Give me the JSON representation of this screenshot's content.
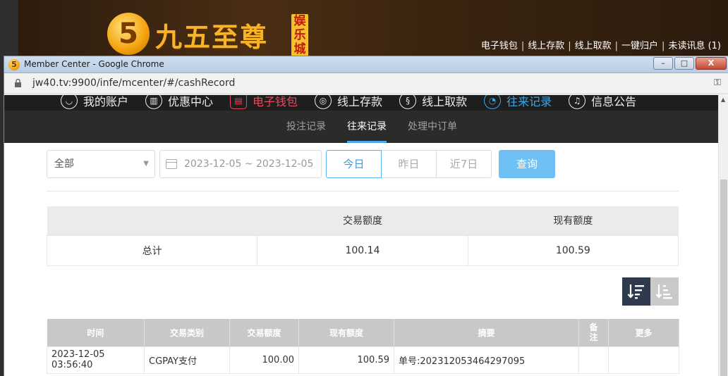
{
  "site": {
    "logo_glyph": "5",
    "logo_text": "九五至尊",
    "logo_badge": "娱乐城",
    "top_links": [
      "电子钱包",
      "线上存款",
      "线上取款",
      "一键归户",
      "未读讯息 (1)"
    ]
  },
  "window": {
    "title": "Member Center - Google Chrome",
    "url": "jw40.tv:9900/infe/mcenter/#/cashRecord",
    "buttons": {
      "minimize": "–",
      "maximize": "□",
      "close": "X"
    }
  },
  "nav": {
    "items": [
      {
        "label": "我的账户",
        "icon": "user-icon"
      },
      {
        "label": "优惠中心",
        "icon": "gift-icon"
      },
      {
        "label": "电子钱包",
        "icon": "wallet-icon",
        "state": "red"
      },
      {
        "label": "线上存款",
        "icon": "deposit-icon"
      },
      {
        "label": "线上取款",
        "icon": "withdraw-icon"
      },
      {
        "label": "往来记录",
        "icon": "records-icon",
        "state": "active"
      },
      {
        "label": "信息公告",
        "icon": "bell-icon"
      }
    ]
  },
  "subnav": {
    "tabs": [
      "投注记录",
      "往来记录",
      "处理中订单"
    ],
    "active": "往来记录"
  },
  "filters": {
    "type_selected": "全部",
    "date_range": "2023-12-05 ~ 2023-12-05",
    "ranges": [
      "今日",
      "昨日",
      "近7日"
    ],
    "active_range": "今日",
    "query_label": "查询"
  },
  "summary": {
    "headers": [
      "",
      "交易额度",
      "现有额度"
    ],
    "row": [
      "总计",
      "100.14",
      "100.59"
    ]
  },
  "records": {
    "headers": [
      "时间",
      "交易类别",
      "交易额度",
      "现有额度",
      "摘要",
      "备注",
      "更多"
    ],
    "rows": [
      [
        "2023-12-05 03:56:40",
        "CGPAY支付",
        "100.00",
        "100.59",
        "单号:202312053464297095",
        "",
        ""
      ]
    ]
  },
  "colors": {
    "accent": "#4aa8e8",
    "query_button": "#6ec0f5",
    "nav_red": "#e64a5f",
    "nav_blue": "#3fa4e6"
  }
}
